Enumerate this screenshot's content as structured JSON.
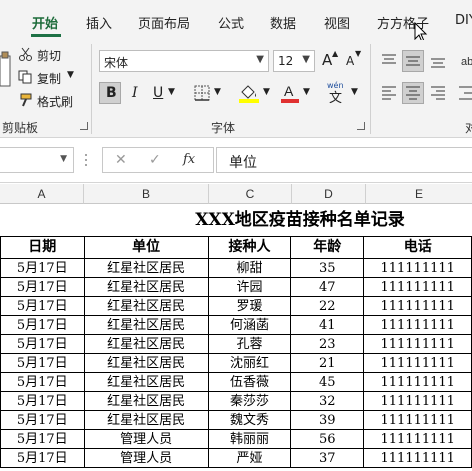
{
  "ribbon_tabs": [
    "开始",
    "插入",
    "页面布局",
    "公式",
    "数据",
    "视图",
    "方方格子",
    "DIY"
  ],
  "ribbon": {
    "clipboard": {
      "cut": "剪切",
      "copy": "复制",
      "format_painter": "格式刷",
      "group": "剪贴板"
    },
    "font": {
      "name": "宋体",
      "size": "12",
      "bold": "B",
      "italic": "I",
      "underline": "U",
      "wen_label": "wén",
      "wen_char": "文",
      "grow": "A",
      "shrink": "A",
      "group": "字体"
    },
    "alignment_group_partial": "对"
  },
  "formula_bar": {
    "name_box": "",
    "cancel_symbol": "✕",
    "enter_symbol": "✓",
    "fx_symbol": "fx",
    "content": "单位"
  },
  "columns": [
    "A",
    "B",
    "C",
    "D",
    "E"
  ],
  "sheet": {
    "title": "XXX地区疫苗接种名单记录",
    "headers": [
      "日期",
      "单位",
      "接种人",
      "年龄",
      "电话"
    ],
    "rows": [
      [
        "5月17日",
        "红星社区居民",
        "柳甜",
        "35",
        "111111111"
      ],
      [
        "5月17日",
        "红星社区居民",
        "许园",
        "47",
        "111111111"
      ],
      [
        "5月17日",
        "红星社区居民",
        "罗瑗",
        "22",
        "111111111"
      ],
      [
        "5月17日",
        "红星社区居民",
        "何涵菡",
        "41",
        "111111111"
      ],
      [
        "5月17日",
        "红星社区居民",
        "孔蓉",
        "23",
        "111111111"
      ],
      [
        "5月17日",
        "红星社区居民",
        "沈丽红",
        "21",
        "111111111"
      ],
      [
        "5月17日",
        "红星社区居民",
        "伍香薇",
        "45",
        "111111111"
      ],
      [
        "5月17日",
        "红星社区居民",
        "秦莎莎",
        "32",
        "111111111"
      ],
      [
        "5月17日",
        "红星社区居民",
        "魏文秀",
        "39",
        "111111111"
      ],
      [
        "5月17日",
        "管理人员",
        "韩丽丽",
        "56",
        "111111111"
      ],
      [
        "5月17日",
        "管理人员",
        "严娅",
        "37",
        "111111111"
      ]
    ]
  },
  "colors": {
    "accent": "#1e7145",
    "font_color": "#e03030",
    "highlight": "#ffff00"
  }
}
